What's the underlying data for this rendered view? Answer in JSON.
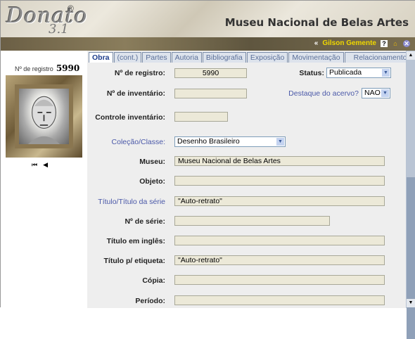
{
  "header": {
    "logo": "Donato",
    "logo_version": "3.1",
    "registered": "®",
    "museum": "Museu Nacional de Belas Artes",
    "back": "«",
    "user": "Gilson Gemente",
    "icons": [
      "help-icon",
      "home-icon",
      "logout-icon"
    ]
  },
  "left": {
    "reg_label": "Nº de registro",
    "reg_value": "5990",
    "first": "⏮",
    "prev": "◀"
  },
  "tabs": [
    "Obra",
    "(cont.)",
    "Partes",
    "Autoria",
    "Bibliografia",
    "Exposição",
    "Movimentação",
    "Relacionamento"
  ],
  "form": {
    "registro": {
      "label": "Nº de registro:",
      "value": "5990"
    },
    "inventario": {
      "label": "Nº de inventário:",
      "value": ""
    },
    "controle": {
      "label": "Controle inventário:",
      "value": ""
    },
    "colecao": {
      "label": "Coleção/Classe:",
      "value": "Desenho Brasileiro"
    },
    "museu": {
      "label": "Museu:",
      "value": "Museu Nacional de Belas Artes"
    },
    "objeto": {
      "label": "Objeto:",
      "value": ""
    },
    "titulo": {
      "label": "Título/Título da série",
      "value": "\"Auto-retrato\""
    },
    "serie": {
      "label": "Nº de série:",
      "value": ""
    },
    "ingles": {
      "label": "Título em inglês:",
      "value": ""
    },
    "etiqueta": {
      "label": "Título p/ etiqueta:",
      "value": "\"Auto-retrato\""
    },
    "copia": {
      "label": "Cópia:",
      "value": ""
    },
    "periodo": {
      "label": "Período:",
      "value": ""
    },
    "status": {
      "label": "Status:",
      "value": "Publicada"
    },
    "destaque": {
      "label": "Destaque do acervo?",
      "value": "NAO"
    }
  }
}
